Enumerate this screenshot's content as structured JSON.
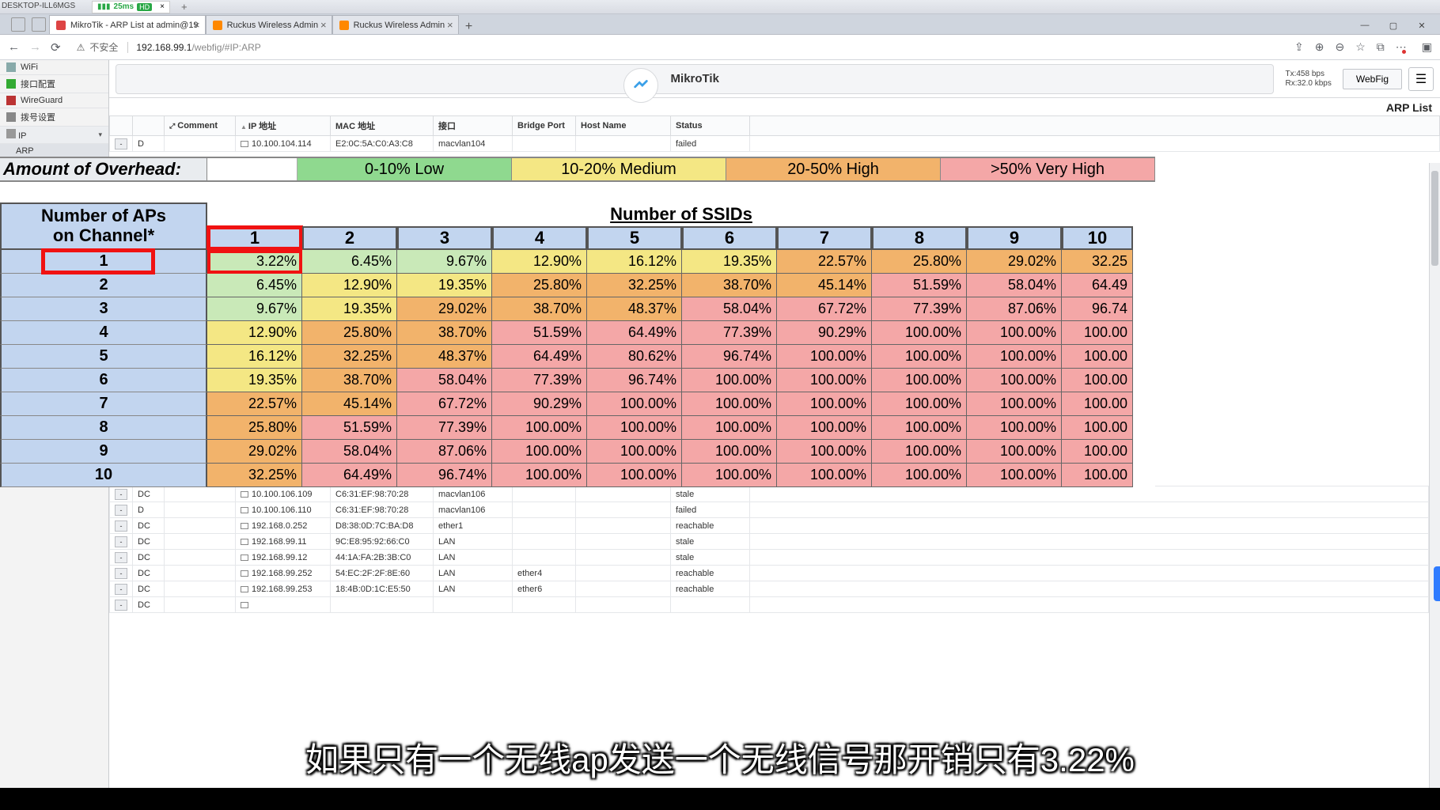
{
  "desktop_tag": "DESKTOP-ILL6MGS",
  "topbar": {
    "ping": "25ms",
    "hd": "HD"
  },
  "tabs": [
    {
      "label": "MikroTik - ARP List at admin@19",
      "active": true
    },
    {
      "label": "Ruckus Wireless Admin",
      "active": false
    },
    {
      "label": "Ruckus Wireless Admin",
      "active": false
    }
  ],
  "address": {
    "insecure": "不安全",
    "host": "192.168.99.1",
    "path": "/webfig/#IP:ARP"
  },
  "sidebar": {
    "wifi": "WiFi",
    "ifconf": "接口配置",
    "wireguard": "WireGuard",
    "dial": "拨号设置",
    "ip": "IP",
    "arp": "ARP"
  },
  "header": {
    "title": "MikroTik",
    "tx": "Tx:458 bps",
    "rx": "Rx:32.0 kbps",
    "webfig": "WebFig",
    "arp_list": "ARP List"
  },
  "columns": {
    "comment": "Comment",
    "ip": "IP 地址",
    "mac": "MAC 地址",
    "iface": "接口",
    "bridge": "Bridge Port",
    "host": "Host Name",
    "status": "Status"
  },
  "arp_rows_top": [
    {
      "flag": "D",
      "ip": "10.100.104.114",
      "mac": "E2:0C:5A:C0:A3:C8",
      "iface": "macvlan104",
      "bp": "",
      "hn": "",
      "status": "failed"
    }
  ],
  "arp_rows_bottom": [
    {
      "flag": "DC",
      "ip": "10.100.106.109",
      "mac": "C6:31:EF:98:70:28",
      "iface": "macvlan106",
      "bp": "",
      "hn": "",
      "status": "stale"
    },
    {
      "flag": "D",
      "ip": "10.100.106.110",
      "mac": "C6:31:EF:98:70:28",
      "iface": "macvlan106",
      "bp": "",
      "hn": "",
      "status": "failed"
    },
    {
      "flag": "DC",
      "ip": "192.168.0.252",
      "mac": "D8:38:0D:7C:BA:D8",
      "iface": "ether1",
      "bp": "",
      "hn": "",
      "status": "reachable"
    },
    {
      "flag": "DC",
      "ip": "192.168.99.11",
      "mac": "9C:E8:95:92:66:C0",
      "iface": "LAN",
      "bp": "",
      "hn": "",
      "status": "stale"
    },
    {
      "flag": "DC",
      "ip": "192.168.99.12",
      "mac": "44:1A:FA:2B:3B:C0",
      "iface": "LAN",
      "bp": "",
      "hn": "",
      "status": "stale"
    },
    {
      "flag": "DC",
      "ip": "192.168.99.252",
      "mac": "54:EC:2F:2F:8E:60",
      "iface": "LAN",
      "bp": "ether4",
      "hn": "",
      "status": "reachable"
    },
    {
      "flag": "DC",
      "ip": "192.168.99.253",
      "mac": "18:4B:0D:1C:E5:50",
      "iface": "LAN",
      "bp": "ether6",
      "hn": "",
      "status": "reachable"
    },
    {
      "flag": "DC",
      "ip": "",
      "mac": "",
      "iface": "",
      "bp": "",
      "hn": "",
      "status": ""
    }
  ],
  "overhead": {
    "label": "Amount of Overhead:",
    "low": "0-10% Low",
    "med": "10-20% Medium",
    "high": "20-50% High",
    "vhigh": ">50% Very High"
  },
  "chart_data": {
    "type": "table",
    "title_ssids": "Number of SSIDs",
    "title_aps": "Number of APs\non Channel*",
    "ssid_headers": [
      "1",
      "2",
      "3",
      "4",
      "5",
      "6",
      "7",
      "8",
      "9",
      "10"
    ],
    "ap_rows": [
      "1",
      "2",
      "3",
      "4",
      "5",
      "6",
      "7",
      "8",
      "9",
      "10"
    ],
    "values": [
      [
        "3.22%",
        "6.45%",
        "9.67%",
        "12.90%",
        "16.12%",
        "19.35%",
        "22.57%",
        "25.80%",
        "29.02%",
        "32.25"
      ],
      [
        "6.45%",
        "12.90%",
        "19.35%",
        "25.80%",
        "32.25%",
        "38.70%",
        "45.14%",
        "51.59%",
        "58.04%",
        "64.49"
      ],
      [
        "9.67%",
        "19.35%",
        "29.02%",
        "38.70%",
        "48.37%",
        "58.04%",
        "67.72%",
        "77.39%",
        "87.06%",
        "96.74"
      ],
      [
        "12.90%",
        "25.80%",
        "38.70%",
        "51.59%",
        "64.49%",
        "77.39%",
        "90.29%",
        "100.00%",
        "100.00%",
        "100.00"
      ],
      [
        "16.12%",
        "32.25%",
        "48.37%",
        "64.49%",
        "80.62%",
        "96.74%",
        "100.00%",
        "100.00%",
        "100.00%",
        "100.00"
      ],
      [
        "19.35%",
        "38.70%",
        "58.04%",
        "77.39%",
        "96.74%",
        "100.00%",
        "100.00%",
        "100.00%",
        "100.00%",
        "100.00"
      ],
      [
        "22.57%",
        "45.14%",
        "67.72%",
        "90.29%",
        "100.00%",
        "100.00%",
        "100.00%",
        "100.00%",
        "100.00%",
        "100.00"
      ],
      [
        "25.80%",
        "51.59%",
        "77.39%",
        "100.00%",
        "100.00%",
        "100.00%",
        "100.00%",
        "100.00%",
        "100.00%",
        "100.00"
      ],
      [
        "29.02%",
        "58.04%",
        "87.06%",
        "100.00%",
        "100.00%",
        "100.00%",
        "100.00%",
        "100.00%",
        "100.00%",
        "100.00"
      ],
      [
        "32.25%",
        "64.49%",
        "96.74%",
        "100.00%",
        "100.00%",
        "100.00%",
        "100.00%",
        "100.00%",
        "100.00%",
        "100.00"
      ]
    ],
    "colors": [
      [
        "g",
        "g",
        "g",
        "y",
        "y",
        "y",
        "o",
        "o",
        "o",
        "o"
      ],
      [
        "g",
        "y",
        "y",
        "o",
        "o",
        "o",
        "o",
        "p",
        "p",
        "p"
      ],
      [
        "g",
        "y",
        "o",
        "o",
        "o",
        "p",
        "p",
        "p",
        "p",
        "p"
      ],
      [
        "y",
        "o",
        "o",
        "p",
        "p",
        "p",
        "p",
        "p",
        "p",
        "p"
      ],
      [
        "y",
        "o",
        "o",
        "p",
        "p",
        "p",
        "p",
        "p",
        "p",
        "p"
      ],
      [
        "y",
        "o",
        "p",
        "p",
        "p",
        "p",
        "p",
        "p",
        "p",
        "p"
      ],
      [
        "o",
        "o",
        "p",
        "p",
        "p",
        "p",
        "p",
        "p",
        "p",
        "p"
      ],
      [
        "o",
        "p",
        "p",
        "p",
        "p",
        "p",
        "p",
        "p",
        "p",
        "p"
      ],
      [
        "o",
        "p",
        "p",
        "p",
        "p",
        "p",
        "p",
        "p",
        "p",
        "p"
      ],
      [
        "o",
        "p",
        "p",
        "p",
        "p",
        "p",
        "p",
        "p",
        "p",
        "p"
      ]
    ]
  },
  "subtitle": "如果只有一个无线ap发送一个无线信号那开销只有3.22%"
}
